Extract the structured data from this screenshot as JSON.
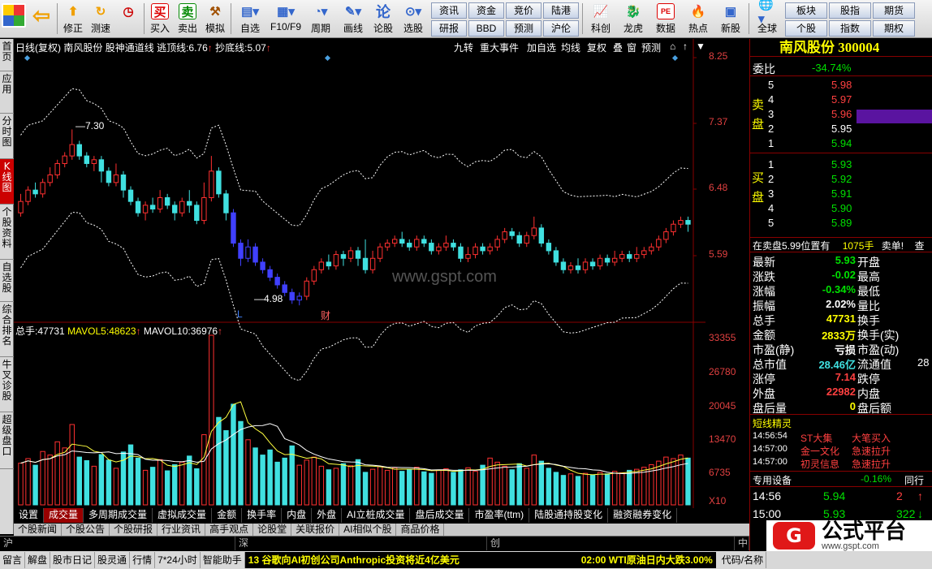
{
  "toolbar": {
    "items_left": [
      {
        "label": "",
        "icon": "logo-grid-icon"
      },
      {
        "label": "",
        "icon": "back-arrow-icon"
      },
      {
        "label": "修正",
        "icon": "repair-icon"
      },
      {
        "label": "测速",
        "icon": "speedtest-icon"
      },
      {
        "label": "买入",
        "icon": "buy-icon"
      },
      {
        "label": "卖出",
        "icon": "sell-icon"
      },
      {
        "label": "模拟",
        "icon": "hammer-icon"
      },
      {
        "label": "自选",
        "icon": "folder-icon"
      },
      {
        "label": "F10/F9",
        "icon": "f10-icon"
      },
      {
        "label": "周期",
        "icon": "clock-icon"
      },
      {
        "label": "画线",
        "icon": "pencil-icon"
      },
      {
        "label": "论股",
        "icon": "discuss-icon"
      },
      {
        "label": "选股",
        "icon": "pick-stock-icon"
      }
    ],
    "grid": [
      "资讯",
      "资金",
      "竞价",
      "陆港",
      "研报",
      "BBD",
      "预测",
      "沪伦"
    ],
    "items_right": [
      {
        "label": "科创",
        "icon": "star-market-icon"
      },
      {
        "label": "龙虎",
        "icon": "dragon-tiger-icon"
      },
      {
        "label": "数据",
        "icon": "data-icon"
      },
      {
        "label": "热点",
        "icon": "hot-icon"
      },
      {
        "label": "新股",
        "icon": "ipo-icon"
      },
      {
        "label": "全球",
        "icon": "globe-icon"
      }
    ],
    "grid2": [
      "板块",
      "股指",
      "期货",
      "个股",
      "指数",
      "期权"
    ]
  },
  "left_tabs": [
    "首页",
    "应用",
    "分时图",
    "K线图",
    "个股资料",
    "自选股",
    "综合排名",
    "牛叉诊股",
    "超级盘口"
  ],
  "chart": {
    "header": {
      "period": "日线(复权)",
      "stock": "南风股份",
      "indicator": "股神通道线",
      "top_label": "逃顶线:",
      "top_value": "6.76",
      "bottom_label": "抄底线:",
      "bottom_value": "5.07"
    },
    "buttons": [
      "九转",
      "重大事件",
      "加自选",
      "均线",
      "复权",
      "叠",
      "窗",
      "预测"
    ],
    "price_axis": [
      "8.25",
      "7.37",
      "6.48",
      "5.59"
    ],
    "high_label": "7.30",
    "low_label": "4.98",
    "watermark": "www.gspt.com",
    "marker_L": "L",
    "marker_cai": "财",
    "volume_header": {
      "vol_label": "总手:",
      "vol": "47731",
      "ma5_label": "MAVOL5:",
      "ma5": "48623",
      "ma10_label": "MAVOL10:",
      "ma10": "36976"
    },
    "volume_axis": [
      "33355",
      "26780",
      "20045",
      "13470",
      "6735"
    ],
    "volume_unit": "X10"
  },
  "chart_data": {
    "type": "candlestick",
    "candles": [
      [
        6.2,
        6.35,
        6.45,
        6.15
      ],
      [
        6.35,
        6.5,
        6.55,
        6.3
      ],
      [
        6.5,
        6.45,
        6.6,
        6.4
      ],
      [
        6.45,
        6.6,
        6.65,
        6.4
      ],
      [
        6.6,
        6.7,
        6.8,
        6.55
      ],
      [
        6.7,
        6.85,
        6.9,
        6.65
      ],
      [
        6.85,
        6.95,
        7.0,
        6.8
      ],
      [
        6.95,
        7.1,
        7.3,
        6.9
      ],
      [
        7.1,
        6.95,
        7.15,
        6.9
      ],
      [
        6.95,
        6.85,
        7.0,
        6.8
      ],
      [
        6.85,
        6.9,
        6.95,
        6.75
      ],
      [
        6.9,
        6.75,
        6.95,
        6.6
      ],
      [
        6.75,
        6.6,
        6.8,
        6.55
      ],
      [
        6.6,
        6.7,
        6.85,
        6.55
      ],
      [
        6.7,
        6.5,
        6.75,
        6.4
      ],
      [
        6.5,
        6.35,
        6.55,
        6.3
      ],
      [
        6.35,
        6.2,
        6.4,
        6.15
      ],
      [
        6.2,
        6.3,
        6.35,
        6.1
      ],
      [
        6.3,
        6.25,
        6.4,
        6.2
      ],
      [
        6.25,
        6.4,
        6.5,
        6.2
      ],
      [
        6.4,
        6.3,
        6.45,
        6.25
      ],
      [
        6.3,
        6.2,
        6.35,
        6.1
      ],
      [
        6.2,
        6.35,
        6.4,
        6.15
      ],
      [
        6.35,
        6.3,
        6.5,
        6.2
      ],
      [
        6.3,
        6.1,
        6.35,
        6.05
      ],
      [
        6.1,
        6.4,
        6.6,
        6.05
      ],
      [
        6.4,
        6.75,
        6.95,
        6.35
      ],
      [
        6.75,
        6.45,
        6.8,
        6.4
      ],
      [
        6.45,
        6.2,
        6.5,
        6.1
      ],
      [
        6.2,
        5.8,
        6.25,
        5.75
      ],
      [
        5.8,
        5.6,
        5.85,
        5.5
      ],
      [
        5.6,
        5.75,
        5.85,
        5.55
      ],
      [
        5.75,
        5.55,
        5.8,
        5.5
      ],
      [
        5.55,
        5.45,
        5.6,
        5.4
      ],
      [
        5.45,
        5.35,
        5.5,
        5.3
      ],
      [
        5.35,
        5.25,
        5.4,
        5.2
      ],
      [
        5.25,
        5.15,
        5.3,
        5.1
      ],
      [
        5.15,
        5.05,
        5.2,
        5.0
      ],
      [
        5.05,
        5.1,
        5.15,
        4.98
      ],
      [
        5.1,
        5.3,
        5.35,
        5.05
      ],
      [
        5.3,
        5.45,
        5.5,
        5.25
      ],
      [
        5.45,
        5.55,
        5.6,
        5.4
      ],
      [
        5.55,
        5.5,
        5.65,
        5.45
      ],
      [
        5.5,
        5.65,
        5.7,
        5.45
      ],
      [
        5.65,
        5.6,
        5.7,
        5.5
      ],
      [
        5.6,
        5.7,
        5.75,
        5.55
      ],
      [
        5.7,
        5.6,
        5.75,
        5.5
      ],
      [
        5.6,
        5.45,
        5.85,
        5.4
      ],
      [
        5.45,
        5.6,
        5.7,
        5.4
      ],
      [
        5.6,
        5.75,
        5.8,
        5.55
      ],
      [
        5.75,
        5.8,
        5.85,
        5.7
      ],
      [
        5.8,
        5.85,
        5.9,
        5.75
      ],
      [
        5.85,
        5.8,
        5.95,
        5.75
      ],
      [
        5.8,
        5.75,
        5.85,
        5.7
      ],
      [
        5.75,
        5.85,
        5.9,
        5.7
      ],
      [
        5.85,
        5.8,
        5.9,
        5.75
      ],
      [
        5.8,
        5.7,
        5.85,
        5.65
      ],
      [
        5.7,
        5.75,
        5.8,
        5.65
      ],
      [
        5.75,
        5.8,
        5.9,
        5.7
      ],
      [
        5.8,
        5.75,
        5.85,
        5.7
      ],
      [
        5.75,
        5.6,
        5.8,
        5.55
      ],
      [
        5.6,
        5.65,
        5.75,
        5.55
      ],
      [
        5.65,
        5.75,
        5.8,
        5.6
      ],
      [
        5.75,
        5.7,
        5.8,
        5.65
      ],
      [
        5.7,
        5.75,
        5.8,
        5.65
      ],
      [
        5.75,
        5.85,
        5.9,
        5.7
      ],
      [
        5.85,
        5.95,
        6.0,
        5.8
      ],
      [
        5.95,
        5.9,
        6.0,
        5.85
      ],
      [
        5.9,
        5.8,
        5.95,
        5.75
      ],
      [
        5.8,
        5.9,
        5.95,
        5.75
      ],
      [
        5.9,
        6.0,
        6.15,
        5.85
      ],
      [
        6.0,
        5.8,
        6.05,
        5.75
      ],
      [
        5.8,
        5.7,
        5.85,
        5.65
      ],
      [
        5.7,
        5.55,
        5.75,
        5.5
      ],
      [
        5.55,
        5.45,
        5.6,
        5.4
      ],
      [
        5.45,
        5.5,
        5.55,
        5.4
      ],
      [
        5.5,
        5.45,
        5.6,
        5.4
      ],
      [
        5.45,
        5.55,
        5.6,
        5.4
      ],
      [
        5.55,
        5.5,
        5.6,
        5.45
      ],
      [
        5.5,
        5.6,
        5.65,
        5.45
      ],
      [
        5.6,
        5.55,
        5.65,
        5.5
      ],
      [
        5.55,
        5.6,
        5.7,
        5.5
      ],
      [
        5.6,
        5.65,
        5.7,
        5.55
      ],
      [
        5.65,
        5.6,
        5.7,
        5.55
      ],
      [
        5.6,
        5.65,
        5.75,
        5.55
      ],
      [
        5.65,
        5.7,
        5.75,
        5.6
      ],
      [
        5.7,
        5.75,
        5.8,
        5.65
      ],
      [
        5.75,
        5.85,
        5.9,
        5.7
      ],
      [
        5.85,
        5.95,
        6.0,
        5.8
      ],
      [
        5.95,
        6.05,
        6.1,
        5.9
      ],
      [
        6.05,
        6.1,
        6.15,
        6.0
      ],
      [
        6.1,
        6.05,
        6.15,
        5.95
      ]
    ],
    "volume": [
      8200,
      9100,
      7800,
      10500,
      9800,
      12400,
      11200,
      15800,
      9400,
      8700,
      7600,
      9900,
      8800,
      7200,
      10400,
      11800,
      9200,
      6800,
      7400,
      8900,
      6700,
      7900,
      8400,
      9600,
      7100,
      13800,
      33355,
      17200,
      14600,
      19800,
      16400,
      12800,
      11200,
      9800,
      10800,
      8400,
      9200,
      11600,
      7800,
      8800,
      9400,
      7600,
      6900,
      7200,
      8100,
      7700,
      8900,
      6400,
      7000,
      7500,
      6800,
      7300,
      6600,
      6900,
      7400,
      6500,
      6200,
      6800,
      7100,
      6400,
      6900,
      7300,
      6600,
      7800,
      9200,
      8400,
      7600,
      6900,
      8100,
      7200,
      9800,
      8600,
      7200,
      6400,
      5800,
      6100,
      5600,
      6200,
      5900,
      6400,
      6100,
      6600,
      6300,
      6800,
      7000,
      7400,
      7900,
      8600,
      9400,
      9100,
      9800,
      9200
    ],
    "ylim": [
      4.8,
      8.3
    ],
    "vol_ylim": [
      0,
      33355
    ]
  },
  "bottom_tabs": [
    "设置",
    "成交量",
    "多周期成交量",
    "虚拟成交量",
    "金额",
    "换手率",
    "内盘",
    "外盘",
    "AI立桩成交量",
    "盘后成交量",
    "市盈率(ttm)",
    "陆股通持股变化",
    "融资融券变化"
  ],
  "news_tabs": [
    "个股新闻",
    "个股公告",
    "个股研报",
    "行业资讯",
    "高手观点",
    "论股堂",
    "关联报价",
    "AI相似个股",
    "商品价格"
  ],
  "market_bar": [
    "沪",
    "深",
    "创",
    "中"
  ],
  "status": {
    "items": [
      "留言",
      "解盘",
      "股市日记",
      "股灵通",
      "行情",
      "7*24小时",
      "智能助手"
    ],
    "ticker_left": "13 谷歌向AI初创公司Anthropic投资将近4亿美元",
    "ticker_right": "02:00 WTI原油日内大跌3.00%",
    "code_label": "代码/名称"
  },
  "quote": {
    "title": "南风股份 300004",
    "weibi_label": "委比",
    "weibi_value": "-34.74%",
    "sell_label": "卖盘",
    "buy_label": "买盘",
    "sells": [
      {
        "lvl": "5",
        "price": "5.98"
      },
      {
        "lvl": "4",
        "price": "5.97"
      },
      {
        "lvl": "3",
        "price": "5.96"
      },
      {
        "lvl": "2",
        "price": "5.95"
      },
      {
        "lvl": "1",
        "price": "5.94"
      }
    ],
    "buys": [
      {
        "lvl": "1",
        "price": "5.93"
      },
      {
        "lvl": "2",
        "price": "5.92"
      },
      {
        "lvl": "3",
        "price": "5.91"
      },
      {
        "lvl": "4",
        "price": "5.90"
      },
      {
        "lvl": "5",
        "price": "5.89"
      }
    ],
    "notice": "在卖盘5.99位置有",
    "notice_vol": "1075手",
    "notice_tail": "卖单!",
    "notice_cut": "查",
    "stats": [
      {
        "l": "最新",
        "v": "5.93",
        "c": "grn",
        "r": "开盘"
      },
      {
        "l": "涨跌",
        "v": "-0.02",
        "c": "grn",
        "r": "最高"
      },
      {
        "l": "涨幅",
        "v": "-0.34%",
        "c": "grn",
        "r": "最低"
      },
      {
        "l": "振幅",
        "v": "2.02%",
        "c": "wht",
        "r": "量比"
      },
      {
        "l": "总手",
        "v": "47731",
        "c": "yel",
        "r": "换手"
      },
      {
        "l": "金额",
        "v": "2833万",
        "c": "yel",
        "r": "换手(实)"
      },
      {
        "l": "市盈(静)",
        "v": "亏损",
        "c": "wht",
        "r": "市盈(动)"
      },
      {
        "l": "总市值",
        "v": "28.46亿",
        "c": "cyan",
        "r": "流通值"
      },
      {
        "l": "涨停",
        "v": "7.14",
        "c": "red",
        "r": "跌停"
      },
      {
        "l": "外盘",
        "v": "22982",
        "c": "red",
        "r": "内盘"
      },
      {
        "l": "盘后量",
        "v": "0",
        "c": "yel",
        "r": "盘后额"
      }
    ],
    "right_cut": "28",
    "short_title": "短线精灵",
    "short": [
      {
        "t": "14:56:54",
        "a": "ST大集",
        "b": "大笔买入"
      },
      {
        "t": "14:57:00",
        "a": "金一文化",
        "b": "急速拉升"
      },
      {
        "t": "14:57:00",
        "a": "初灵信息",
        "b": "急速拉升"
      }
    ],
    "sector_label": "专用设备",
    "sector_value": "-0.16%",
    "sector_tail": "同行",
    "ticks": [
      {
        "t": "14:56",
        "p": "5.94",
        "v": "2"
      },
      {
        "t": "15:00",
        "p": "5.93",
        "v": "322"
      }
    ]
  },
  "brand": {
    "name": "公式平台",
    "url": "www.gspt.com"
  },
  "colors": {
    "up": "#ff3030",
    "down": "#40e0e0",
    "bg": "#000000",
    "grid": "#800000",
    "accent_blue": "#4040ff"
  }
}
